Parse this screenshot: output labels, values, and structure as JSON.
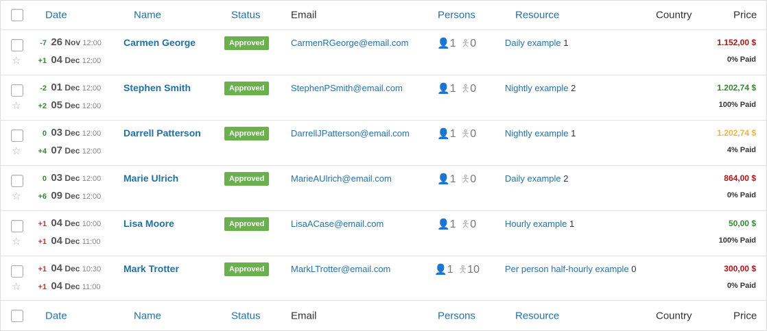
{
  "header": {
    "date": "Date",
    "name": "Name",
    "status": "Status",
    "email": "Email",
    "persons": "Persons",
    "resource": "Resource",
    "country": "Country",
    "price": "Price"
  },
  "icons": {
    "checkbox": "checkbox-icon",
    "star": "star-icon",
    "adult": "person-icon",
    "child": "child-icon"
  },
  "colors": {
    "link": "#2271b1",
    "badge": "#6ab04c",
    "price_red": "#b51212",
    "price_green": "#2e8b2e",
    "price_orange": "#f0b43a"
  },
  "rows": [
    {
      "start_offset": "-7",
      "start_day": "26",
      "start_month": "Nov",
      "start_time": "12:00",
      "end_offset": "+1",
      "end_day": "04",
      "end_month": "Dec",
      "end_time": "12:00",
      "name": "Carmen George",
      "status": "Approved",
      "email": "CarmenRGeorge@email.com",
      "adults": "1",
      "children": "0",
      "resource": "Daily example",
      "resource_count": "1",
      "price": "1.152,00 $",
      "paid": "0% Paid"
    },
    {
      "start_offset": "-2",
      "start_day": "01",
      "start_month": "Dec",
      "start_time": "12:00",
      "end_offset": "+2",
      "end_day": "05",
      "end_month": "Dec",
      "end_time": "12:00",
      "name": "Stephen Smith",
      "status": "Approved",
      "email": "StephenPSmith@email.com",
      "adults": "1",
      "children": "0",
      "resource": "Nightly example",
      "resource_count": "2",
      "price": "1.202,74 $",
      "paid": "100% Paid"
    },
    {
      "start_offset": "0",
      "start_day": "03",
      "start_month": "Dec",
      "start_time": "12:00",
      "end_offset": "+4",
      "end_day": "07",
      "end_month": "Dec",
      "end_time": "12:00",
      "name": "Darrell Patterson",
      "status": "Approved",
      "email": "DarrellJPatterson@email.com",
      "adults": "1",
      "children": "0",
      "resource": "Nightly example",
      "resource_count": "1",
      "price": "1.202,74 $",
      "paid": "4% Paid"
    },
    {
      "start_offset": "0",
      "start_day": "03",
      "start_month": "Dec",
      "start_time": "12:00",
      "end_offset": "+6",
      "end_day": "09",
      "end_month": "Dec",
      "end_time": "12:00",
      "name": "Marie Ulrich",
      "status": "Approved",
      "email": "MarieAUlrich@email.com",
      "adults": "1",
      "children": "0",
      "resource": "Daily example",
      "resource_count": "2",
      "price": "864,00 $",
      "paid": "0% Paid"
    },
    {
      "start_offset": "+1",
      "start_day": "04",
      "start_month": "Dec",
      "start_time": "10:00",
      "end_offset": "+1",
      "end_day": "04",
      "end_month": "Dec",
      "end_time": "11:00",
      "name": "Lisa Moore",
      "status": "Approved",
      "email": "LisaACase@email.com",
      "adults": "1",
      "children": "0",
      "resource": "Hourly example",
      "resource_count": "1",
      "price": "50,00 $",
      "paid": "100% Paid"
    },
    {
      "start_offset": "+1",
      "start_day": "04",
      "start_month": "Dec",
      "start_time": "10:30",
      "end_offset": "+1",
      "end_day": "04",
      "end_month": "Dec",
      "end_time": "11:00",
      "name": "Mark Trotter",
      "status": "Approved",
      "email": "MarkLTrotter@email.com",
      "adults": "1",
      "children": "10",
      "resource": "Per person half-hourly example",
      "resource_count": "0",
      "price": "300,00 $",
      "paid": "0% Paid"
    }
  ]
}
